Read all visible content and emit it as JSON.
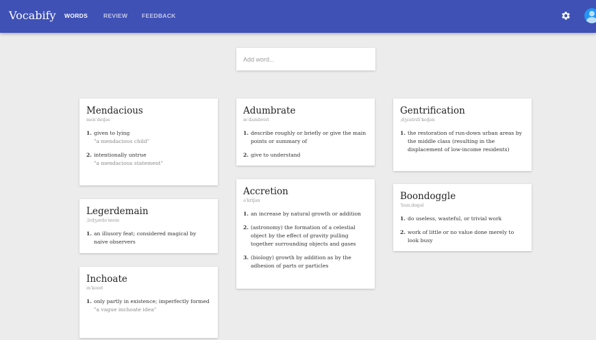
{
  "header": {
    "brand": "Vocabify",
    "nav": [
      "WORDS",
      "REVIEW",
      "FEEDBACK"
    ],
    "active_tab": "WORDS",
    "accent": "#3f51b5",
    "icons": [
      "gear-icon",
      "avatar-icon"
    ]
  },
  "search": {
    "placeholder": "Add word..."
  },
  "cards": {
    "mendacious": {
      "word": "Mendacious",
      "phonetic": "mɛnˈdeɪʃəs",
      "defs": [
        {
          "n": "1.",
          "text": "given to lying",
          "example": "\"a mendacious child\""
        },
        {
          "n": "2.",
          "text": "intentionally untrue",
          "example": "\"a mendacious statement\""
        }
      ]
    },
    "legerdemain": {
      "word": "Legerdemain",
      "phonetic": "ˌlɛdʒərdəˈmeɪn",
      "defs": [
        {
          "n": "1.",
          "text": "an illusory feat; considered magical by naive observers"
        }
      ]
    },
    "inchoate": {
      "word": "Inchoate",
      "phonetic": "ɪnˈkoʊɪt",
      "defs": [
        {
          "n": "1.",
          "text": "only partly in existence; imperfectly formed",
          "example": "\"a vague inchoate idea\""
        }
      ]
    },
    "adumbrate": {
      "word": "Adumbrate",
      "phonetic": "æˈdʌmbreɪt",
      "defs": [
        {
          "n": "1.",
          "text": "describe roughly or briefly or give the main points or summary of"
        },
        {
          "n": "2.",
          "text": "give to understand"
        }
      ]
    },
    "accretion": {
      "word": "Accretion",
      "phonetic": "əˈkriʃən",
      "defs": [
        {
          "n": "1.",
          "text": "an increase by natural growth or addition"
        },
        {
          "n": "2.",
          "text": "(astronomy) the formation of a celestial object by the effect of gravity pulling together surrounding objects and gases"
        },
        {
          "n": "3.",
          "text": "(biology) growth by addition as by the adhesion of parts or particles"
        }
      ]
    },
    "gentrification": {
      "word": "Gentrification",
      "phonetic": "ˌdʒɛntrɪfɪˈkeɪʃən",
      "defs": [
        {
          "n": "1.",
          "text": "the restoration of run-down urban areas by the middle class (resulting in the displacement of low-income residents)"
        }
      ]
    },
    "boondoggle": {
      "word": "Boondoggle",
      "phonetic": "ˈbunˌdɑgəl",
      "defs": [
        {
          "n": "1.",
          "text": "do useless, wasteful, or trivial work"
        },
        {
          "n": "2.",
          "text": "work of little or no value done merely to look busy"
        }
      ]
    }
  }
}
